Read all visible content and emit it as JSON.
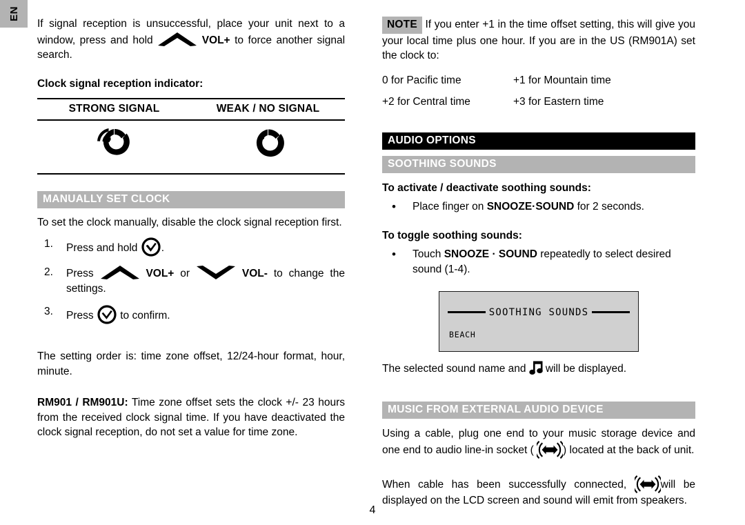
{
  "language_tab": "EN",
  "page_number": "4",
  "left_column": {
    "intro_paragraph": {
      "part1": "If signal reception is unsuccessful, place your unit next to a window, press and hold",
      "icon": "chevron-up-icon",
      "part2": "VOL+",
      "part3": "to force another signal search."
    },
    "indicator_heading": "Clock signal reception indicator:",
    "signal_table": {
      "columns": [
        "STRONG SIGNAL",
        "WEAK / NO SIGNAL"
      ],
      "icons": [
        "strong-signal-icon",
        "weak-signal-icon"
      ]
    },
    "manual_clock": {
      "heading": "MANUALLY SET CLOCK",
      "intro": "To set the clock manually, disable the clock signal reception first.",
      "steps": [
        {
          "num": "1.",
          "text_before": "Press and hold",
          "icon": "clock-confirm-icon",
          "text_after": "."
        },
        {
          "num": "2.",
          "text_before": "Press",
          "icon1": "chevron-up-icon",
          "label1": "VOL+",
          "mid": "or",
          "icon2": "chevron-down-icon",
          "label2": "VOL-",
          "text_after": "to change the settings."
        },
        {
          "num": "3.",
          "text_before": "Press",
          "icon": "clock-confirm-icon",
          "text_after": "to confirm."
        }
      ],
      "setting_order": "The setting order is: time zone offset, 12/24-hour format, hour, minute.",
      "model_note_bold": "RM901 / RM901U:",
      "model_note_text": "Time zone offset sets the clock +/- 23 hours from the received clock signal time. If you have deactivated the clock signal reception, do not set a value for time zone."
    }
  },
  "right_column": {
    "note": {
      "badge": "NOTE",
      "text": "If you enter +1 in the time offset setting, this will give you your local time plus one hour.  If you are in the US (RM901A) set the clock to:",
      "timezones": [
        "0 for Pacific time",
        "+1 for Mountain time",
        "+2 for Central time",
        "+3 for Eastern time"
      ]
    },
    "audio_options": {
      "heading": "AUDIO OPTIONS",
      "soothing_sounds": {
        "heading": "SOOTHING SOUNDS",
        "activate_subhead": "To activate / deactivate soothing sounds:",
        "activate_bullet": {
          "before": "Place finger on",
          "bold": "SNOOZE·SOUND",
          "after": "for 2 seconds."
        },
        "toggle_subhead": "To toggle soothing sounds:",
        "toggle_bullet": {
          "before": "Touch",
          "bold": "SNOOZE · SOUND",
          "after": "repeatedly to select desired sound (1-4)."
        },
        "lcd": {
          "title": "SOOTHING SOUNDS",
          "selection": "BEACH"
        },
        "caption_before": "The selected sound name and",
        "caption_icon": "music-note-icon",
        "caption_after": "will be displayed."
      },
      "external_audio": {
        "heading": "MUSIC FROM EXTERNAL AUDIO DEVICE",
        "paragraph1_before": "Using a cable, plug one end to your music storage device and one end to audio line-in socket (",
        "paragraph1_icon": "audio-line-in-icon",
        "paragraph1_after": ") located at the back of unit.",
        "paragraph2_before": "When cable has been successfully connected,",
        "paragraph2_icon": "audio-line-in-icon",
        "paragraph2_after": "will be displayed on the LCD screen and sound will emit from speakers."
      }
    }
  },
  "colors": {
    "header_black": "#000000",
    "header_gray": "#b3b3b3",
    "lcd_background": "#d0d0d0",
    "page_background": "#ffffff"
  }
}
